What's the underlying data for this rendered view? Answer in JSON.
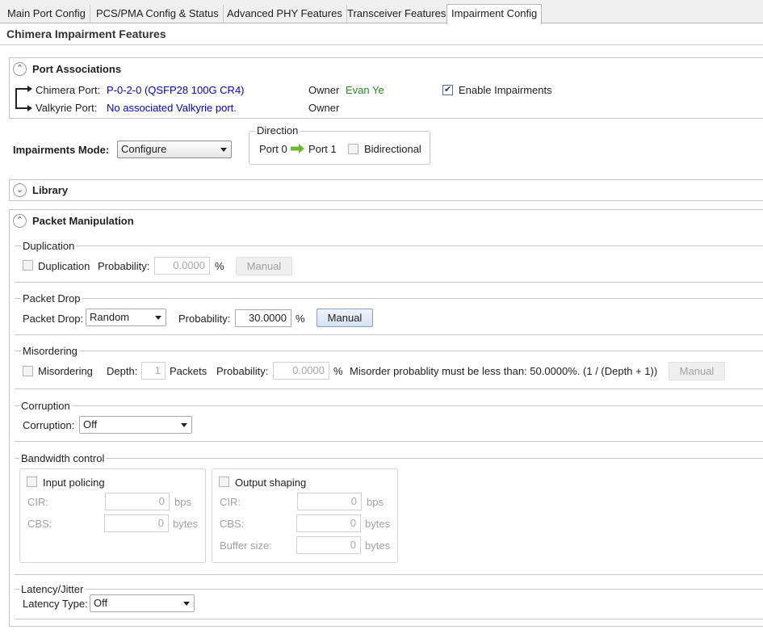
{
  "tabs": {
    "main_port": "Main Port Config",
    "pcs_pma": "PCS/PMA Config & Status",
    "adv_phy": "Advanced PHY Features",
    "transceiver": "Transceiver Features",
    "impairment": "Impairment Config"
  },
  "page_title": "Chimera Impairment Features",
  "port_assoc": {
    "title": "Port Associations",
    "chimera_label": "Chimera Port:",
    "chimera_value": "P-0-2-0 (QSFP28 100G CR4)",
    "owner_label": "Owner",
    "owner_value": "Evan Ye",
    "enable_label": "Enable Impairments",
    "enable_checked": true,
    "valkyrie_label": "Valkyrie Port:",
    "valkyrie_value": "No associated Valkyrie port.",
    "owner2_label": "Owner"
  },
  "mode": {
    "label": "Impairments Mode:",
    "value": "Configure"
  },
  "direction": {
    "legend": "Direction",
    "from": "Port 0",
    "to": "Port 1",
    "bidirectional_label": "Bidirectional"
  },
  "library": {
    "title": "Library"
  },
  "packet_manipulation": {
    "title": "Packet Manipulation",
    "duplication": {
      "legend": "Duplication",
      "checkbox_label": "Duplication",
      "prob_label": "Probability:",
      "prob_value": "0.0000",
      "unit": "%",
      "manual": "Manual"
    },
    "drop": {
      "legend": "Packet Drop",
      "label": "Packet Drop:",
      "value": "Random",
      "prob_label": "Probability:",
      "prob_value": "30.0000",
      "unit": "%",
      "manual": "Manual"
    },
    "misordering": {
      "legend": "Misordering",
      "checkbox_label": "Misordering",
      "depth_label": "Depth:",
      "depth_value": "1",
      "packets_label": "Packets",
      "prob_label": "Probability:",
      "prob_value": "0.0000",
      "unit": "%",
      "note": "Misorder probablity must be less than: 50.0000%. (1 / (Depth + 1))",
      "manual": "Manual"
    },
    "corruption": {
      "legend": "Corruption",
      "label": "Corruption:",
      "value": "Off"
    },
    "bandwidth": {
      "legend": "Bandwidth control",
      "input_policing": {
        "label": "Input policing",
        "cir_label": "CIR:",
        "cir_value": "0",
        "cir_unit": "bps",
        "cbs_label": "CBS:",
        "cbs_value": "0",
        "cbs_unit": "bytes"
      },
      "output_shaping": {
        "label": "Output shaping",
        "cir_label": "CIR:",
        "cir_value": "0",
        "cir_unit": "bps",
        "cbs_label": "CBS:",
        "cbs_value": "0",
        "cbs_unit": "bytes",
        "buf_label": "Buffer size:",
        "buf_value": "0",
        "buf_unit": "bytes"
      }
    },
    "latency": {
      "legend": "Latency/Jitter",
      "label": "Latency Type:",
      "value": "Off"
    }
  }
}
